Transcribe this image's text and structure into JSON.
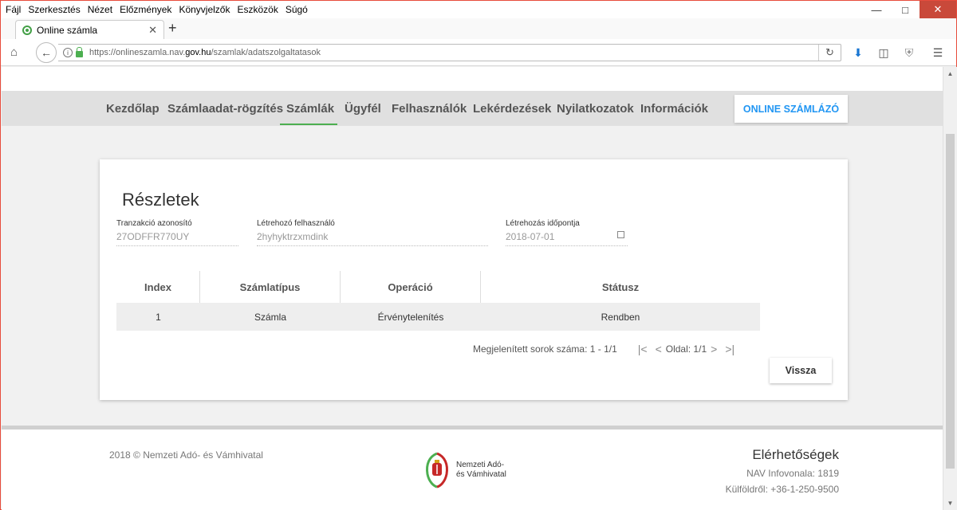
{
  "browser": {
    "menu": [
      "Fájl",
      "Szerkesztés",
      "Nézet",
      "Előzmények",
      "Könyvjelzők",
      "Eszközök",
      "Súgó"
    ],
    "tab_title": "Online számla",
    "url_prefix": "https://onlineszamla.nav.",
    "url_domain": "gov.hu",
    "url_path": "/szamlak/adatszolgaltatasok"
  },
  "nav": {
    "items": [
      "Kezdőlap",
      "Számlaadat-rögzítés",
      "Számlák",
      "Ügyfél",
      "Felhasználók",
      "Lekérdezések",
      "Nyilatkozatok",
      "Információk"
    ],
    "active": "Számlák",
    "online_button": "ONLINE SZÁMLÁZÓ"
  },
  "details": {
    "title": "Részletek",
    "fields": [
      {
        "label": "Tranzakció azonosító",
        "value": "27ODFFR770UY"
      },
      {
        "label": "Létrehozó felhasználó",
        "value": "2hyhyktrzxmdink"
      },
      {
        "label": "Létrehozás időpontja",
        "value": "2018-07-01"
      }
    ],
    "table": {
      "headers": [
        "Index",
        "Számlatípus",
        "Operáció",
        "Státusz"
      ],
      "rows": [
        [
          "1",
          "Számla",
          "Érvénytelenítés",
          "Rendben"
        ]
      ]
    },
    "pager": {
      "rows_text": "Megjelenített sorok száma: 1 - 1/1",
      "page_text": "Oldal: 1/1"
    },
    "back_button": "Vissza"
  },
  "footer": {
    "copyright": "2018 © Nemzeti Adó- és Vámhivatal",
    "logo_line1": "Nemzeti Adó-",
    "logo_line2": "és Vámhivatal",
    "contact_title": "Elérhetőségek",
    "infoline": "NAV Infovonala: 1819",
    "abroad": "Külföldről: +36-1-250-9500"
  }
}
